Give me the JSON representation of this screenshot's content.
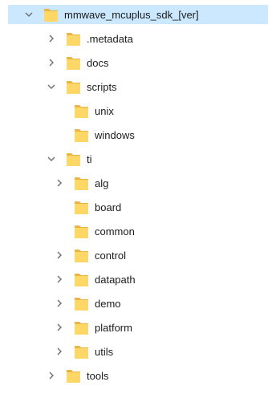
{
  "tree": {
    "items": [
      {
        "label": "mmwave_mcuplus_sdk_[ver]",
        "state": "expanded",
        "selected": true
      },
      {
        "label": ".metadata",
        "state": "collapsed"
      },
      {
        "label": "docs",
        "state": "collapsed"
      },
      {
        "label": "scripts",
        "state": "expanded"
      },
      {
        "label": "unix",
        "state": "leaf"
      },
      {
        "label": "windows",
        "state": "leaf"
      },
      {
        "label": "ti",
        "state": "expanded"
      },
      {
        "label": "alg",
        "state": "collapsed"
      },
      {
        "label": "board",
        "state": "leaf"
      },
      {
        "label": "common",
        "state": "leaf"
      },
      {
        "label": "control",
        "state": "collapsed"
      },
      {
        "label": "datapath",
        "state": "collapsed"
      },
      {
        "label": "demo",
        "state": "collapsed"
      },
      {
        "label": "platform",
        "state": "collapsed"
      },
      {
        "label": "utils",
        "state": "collapsed"
      },
      {
        "label": "tools",
        "state": "collapsed"
      }
    ]
  },
  "colors": {
    "selection": "#cce8ff",
    "folder_body": "#ffd766",
    "folder_tab": "#e9b645",
    "caret": "#6e6e6e",
    "text": "#1b1b1b"
  },
  "icons": {
    "expanded": "chevron-down-icon",
    "collapsed": "chevron-right-icon",
    "folder": "folder-icon"
  }
}
